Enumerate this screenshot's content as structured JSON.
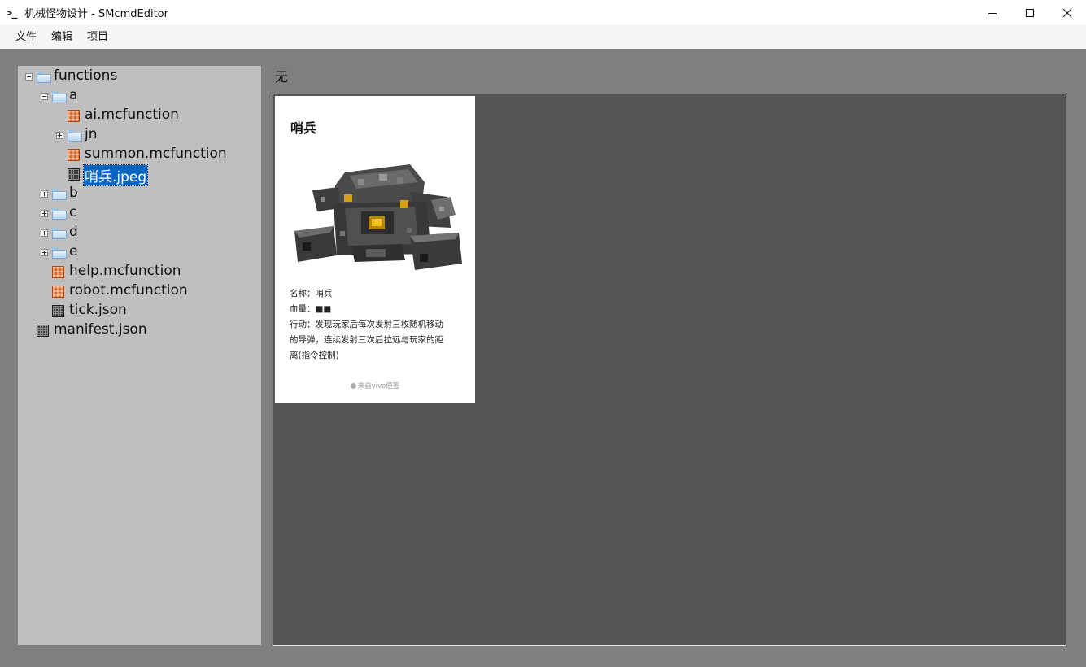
{
  "window": {
    "app_icon": ">_",
    "title": "机械怪物设计 - SMcmdEditor",
    "controls": [
      "minimize",
      "maximize",
      "close"
    ]
  },
  "menu": {
    "items": [
      "文件",
      "编辑",
      "项目"
    ]
  },
  "tree": {
    "nodes": [
      {
        "label": "functions",
        "type": "folder",
        "expanded": true
      },
      {
        "label": "a",
        "type": "folder",
        "expanded": true
      },
      {
        "label": "ai.mcfunction",
        "type": "mcfunction"
      },
      {
        "label": "jn",
        "type": "folder",
        "expanded": false
      },
      {
        "label": "summon.mcfunction",
        "type": "mcfunction"
      },
      {
        "label": "哨兵.jpeg",
        "type": "file",
        "selected": true
      },
      {
        "label": "b",
        "type": "folder",
        "expanded": false
      },
      {
        "label": "c",
        "type": "folder",
        "expanded": false
      },
      {
        "label": "d",
        "type": "folder",
        "expanded": false
      },
      {
        "label": "e",
        "type": "folder",
        "expanded": false
      },
      {
        "label": "help.mcfunction",
        "type": "mcfunction"
      },
      {
        "label": "robot.mcfunction",
        "type": "mcfunction"
      },
      {
        "label": "tick.json",
        "type": "file"
      },
      {
        "label": "manifest.json",
        "type": "file"
      }
    ]
  },
  "status": {
    "label": "无"
  },
  "preview": {
    "card": {
      "title": "哨兵",
      "line_name": "名称：哨兵",
      "line_hp": "血量：■■",
      "line_action_1": "行动：发现玩家后每次发射三枚随机移动",
      "line_action_2": "的导弹，连续发射三次后拉远与玩家的距",
      "line_action_3": "离(指令控制)",
      "footer": "来自vivo便签"
    }
  },
  "colors": {
    "selection": "#0a66c2",
    "tree_bg": "#bfbfbf",
    "preview_bg": "#555558",
    "window_bg": "#7f7f7f"
  }
}
